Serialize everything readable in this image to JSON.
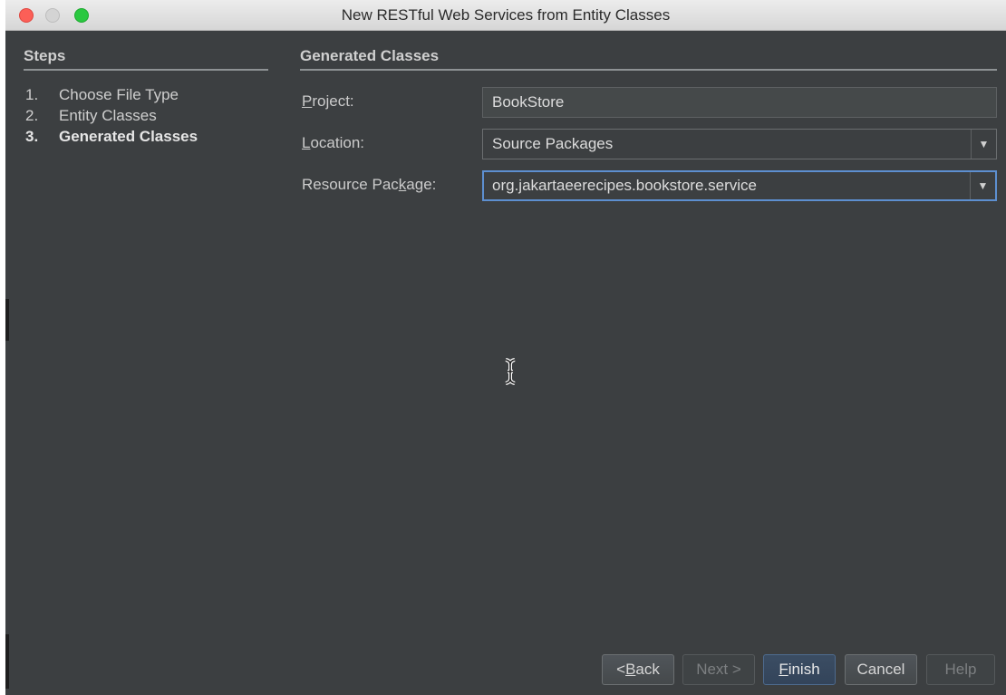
{
  "window": {
    "title": "New RESTful Web Services from Entity Classes"
  },
  "steps": {
    "heading": "Steps",
    "items": [
      {
        "num": "1.",
        "label": "Choose File Type"
      },
      {
        "num": "2.",
        "label": "Entity Classes"
      },
      {
        "num": "3.",
        "label": "Generated Classes"
      }
    ],
    "active_index": 2
  },
  "form": {
    "heading": "Generated Classes",
    "project": {
      "label_pre": "",
      "label_mnemonic": "P",
      "label_post": "roject:",
      "value": "BookStore"
    },
    "location": {
      "label_pre": "",
      "label_mnemonic": "L",
      "label_post": "ocation:",
      "value": "Source Packages"
    },
    "resource_package": {
      "label_pre": "Resource Pac",
      "label_mnemonic": "k",
      "label_post": "age:",
      "value": "org.jakartaeerecipes.bookstore.service"
    }
  },
  "buttons": {
    "back": {
      "pre": "< ",
      "mnemonic": "B",
      "post": "ack"
    },
    "next": "Next >",
    "finish": {
      "mnemonic": "F",
      "post": "inish"
    },
    "cancel": "Cancel",
    "help": "Help"
  },
  "icons": {
    "cursor": "text-cursor-icon",
    "dropdown": "chevron-down-icon"
  },
  "colors": {
    "background": "#3c3f41",
    "focus_border": "#5d8fd0",
    "default_button": "#3b4d63"
  }
}
